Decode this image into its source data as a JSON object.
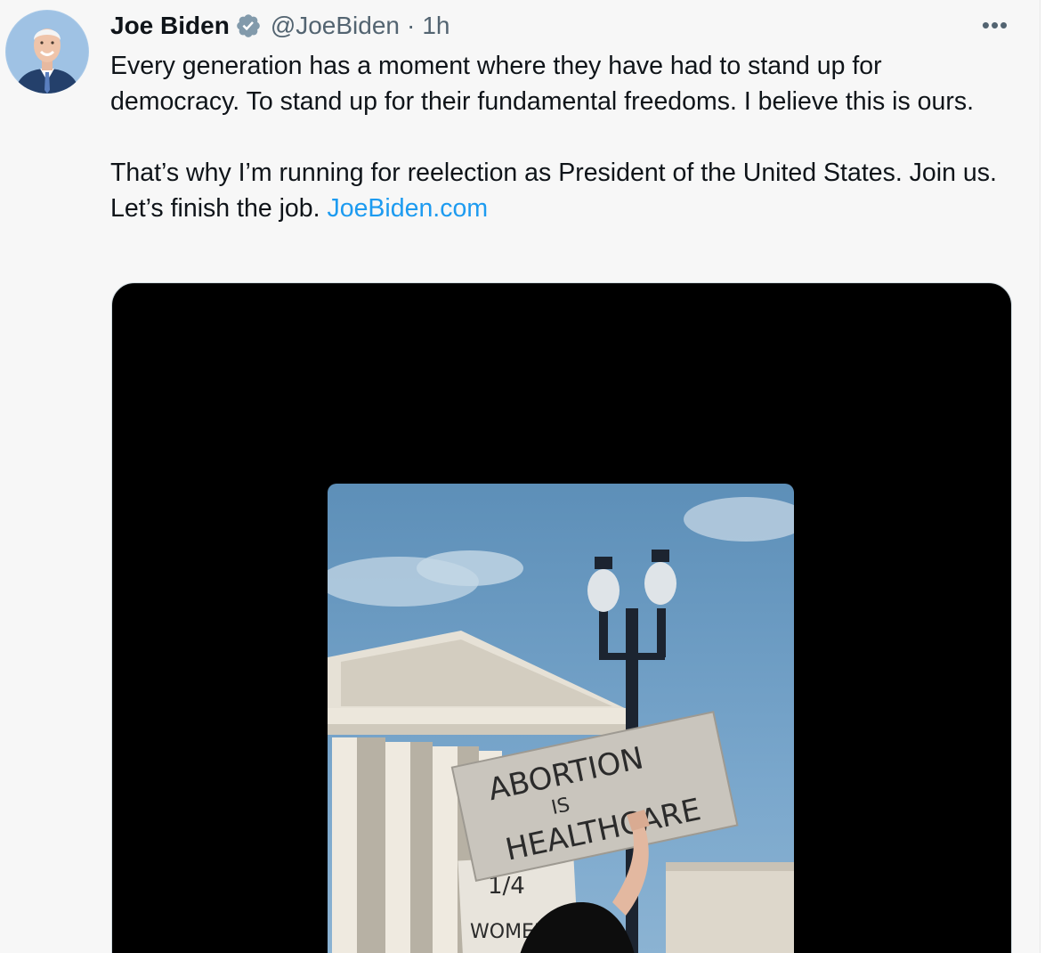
{
  "tweet": {
    "author_name": "Joe Biden",
    "handle": "@JoeBiden",
    "separator": "·",
    "time": "1h",
    "more_icon": "more-options-icon",
    "more_label": "•••",
    "verified_icon": "verified-badge-icon",
    "paragraph1": "Every generation has a moment where they have had to stand up for democracy. To stand up for their fundamental freedoms. I believe this is ours.",
    "paragraph2_text": "That’s why I’m running for reelection as President of the United States. Join us. Let’s finish the job. ",
    "link_text": "JoeBiden.com",
    "media": {
      "sign_lines": [
        "ABORTION",
        "IS",
        "HEALTHCARE"
      ],
      "small_sign_lines": [
        "1/4",
        "WOMEN"
      ]
    }
  },
  "colors": {
    "link": "#1d9bf0",
    "verified": "#829aab",
    "secondary_text": "#536471"
  }
}
